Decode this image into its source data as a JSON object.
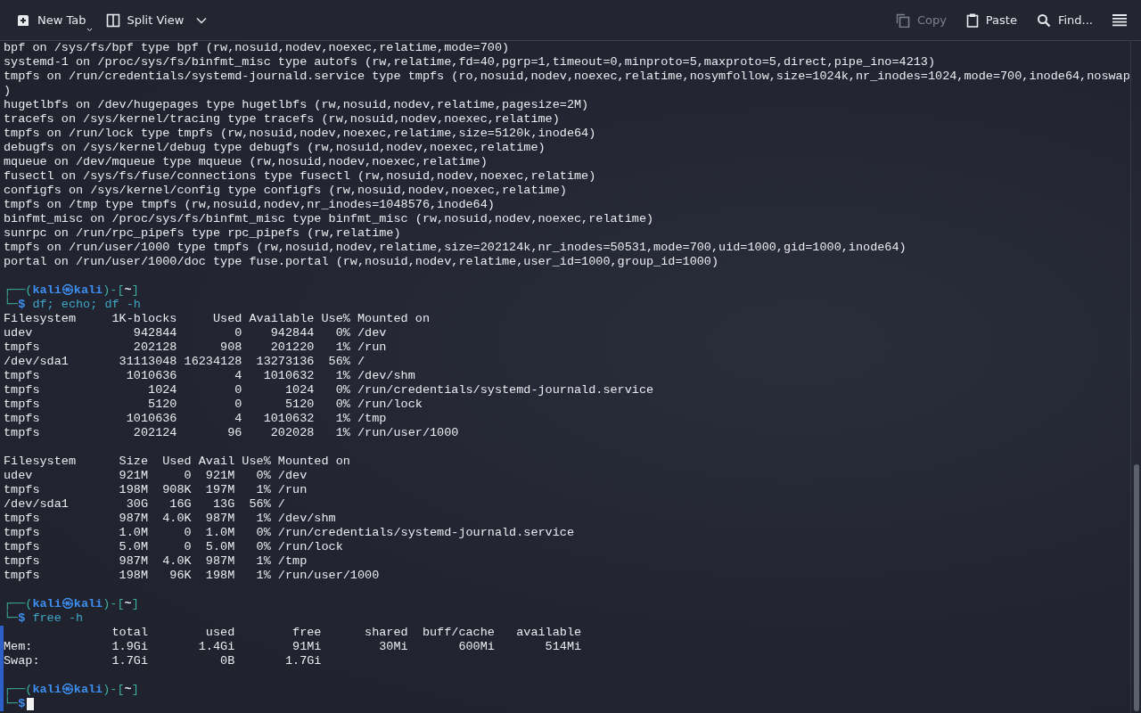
{
  "toolbar": {
    "left": [
      {
        "kind": "new-tab",
        "label": "New Tab",
        "disabled": false
      },
      {
        "kind": "split-view",
        "label": "Split View",
        "disabled": false
      }
    ],
    "right": [
      {
        "kind": "copy",
        "label": "Copy",
        "disabled": true
      },
      {
        "kind": "paste",
        "label": "Paste",
        "disabled": false
      },
      {
        "kind": "find",
        "label": "Find...",
        "disabled": false
      }
    ]
  },
  "terminal": {
    "lines": [
      {
        "kind": "output",
        "text": "bpf on /sys/fs/bpf type bpf (rw,nosuid,nodev,noexec,relatime,mode=700)",
        "marked": false
      },
      {
        "kind": "output",
        "text": "systemd-1 on /proc/sys/fs/binfmt_misc type autofs (rw,relatime,fd=40,pgrp=1,timeout=0,minproto=5,maxproto=5,direct,pipe_ino=4213)",
        "marked": false
      },
      {
        "kind": "output",
        "text": "tmpfs on /run/credentials/systemd-journald.service type tmpfs (ro,nosuid,nodev,noexec,relatime,nosymfollow,size=1024k,nr_inodes=1024,mode=700,inode64,noswap",
        "marked": false
      },
      {
        "kind": "output",
        "text": ")",
        "marked": false
      },
      {
        "kind": "output",
        "text": "hugetlbfs on /dev/hugepages type hugetlbfs (rw,nosuid,nodev,relatime,pagesize=2M)",
        "marked": false
      },
      {
        "kind": "output",
        "text": "tracefs on /sys/kernel/tracing type tracefs (rw,nosuid,nodev,noexec,relatime)",
        "marked": false
      },
      {
        "kind": "output",
        "text": "tmpfs on /run/lock type tmpfs (rw,nosuid,nodev,noexec,relatime,size=5120k,inode64)",
        "marked": false
      },
      {
        "kind": "output",
        "text": "debugfs on /sys/kernel/debug type debugfs (rw,nosuid,nodev,noexec,relatime)",
        "marked": false
      },
      {
        "kind": "output",
        "text": "mqueue on /dev/mqueue type mqueue (rw,nosuid,nodev,noexec,relatime)",
        "marked": false
      },
      {
        "kind": "output",
        "text": "fusectl on /sys/fs/fuse/connections type fusectl (rw,nosuid,nodev,noexec,relatime)",
        "marked": false
      },
      {
        "kind": "output",
        "text": "configfs on /sys/kernel/config type configfs (rw,nosuid,nodev,noexec,relatime)",
        "marked": false
      },
      {
        "kind": "output",
        "text": "tmpfs on /tmp type tmpfs (rw,nosuid,nodev,nr_inodes=1048576,inode64)",
        "marked": false
      },
      {
        "kind": "output",
        "text": "binfmt_misc on /proc/sys/fs/binfmt_misc type binfmt_misc (rw,nosuid,nodev,noexec,relatime)",
        "marked": false
      },
      {
        "kind": "output",
        "text": "sunrpc on /run/rpc_pipefs type rpc_pipefs (rw,relatime)",
        "marked": false
      },
      {
        "kind": "output",
        "text": "tmpfs on /run/user/1000 type tmpfs (rw,nosuid,nodev,relatime,size=202124k,nr_inodes=50531,mode=700,uid=1000,gid=1000,inode64)",
        "marked": false
      },
      {
        "kind": "output",
        "text": "portal on /run/user/1000/doc type fuse.portal (rw,nosuid,nodev,relatime,user_id=1000,group_id=1000)",
        "marked": false
      },
      {
        "kind": "blank",
        "marked": false
      },
      {
        "kind": "prompt",
        "open": "┌──(",
        "user": "kali",
        "at": "㉿",
        "host": "kali",
        "mid": ")-[",
        "dir": "~",
        "close": "]",
        "marked": false
      },
      {
        "kind": "command",
        "corner": "└─",
        "sign": "$",
        "command": "df; echo; df -h",
        "cursor": false,
        "marked": false
      },
      {
        "kind": "output",
        "text": "Filesystem     1K-blocks     Used Available Use% Mounted on",
        "marked": false
      },
      {
        "kind": "output",
        "text": "udev              942844        0    942844   0% /dev",
        "marked": false
      },
      {
        "kind": "output",
        "text": "tmpfs             202128      908    201220   1% /run",
        "marked": false
      },
      {
        "kind": "output",
        "text": "/dev/sda1       31113048 16234128  13273136  56% /",
        "marked": false
      },
      {
        "kind": "output",
        "text": "tmpfs            1010636        4   1010632   1% /dev/shm",
        "marked": false
      },
      {
        "kind": "output",
        "text": "tmpfs               1024        0      1024   0% /run/credentials/systemd-journald.service",
        "marked": false
      },
      {
        "kind": "output",
        "text": "tmpfs               5120        0      5120   0% /run/lock",
        "marked": false
      },
      {
        "kind": "output",
        "text": "tmpfs            1010636        4   1010632   1% /tmp",
        "marked": false
      },
      {
        "kind": "output",
        "text": "tmpfs             202124       96    202028   1% /run/user/1000",
        "marked": false
      },
      {
        "kind": "blank",
        "marked": false
      },
      {
        "kind": "output",
        "text": "Filesystem      Size  Used Avail Use% Mounted on",
        "marked": false
      },
      {
        "kind": "output",
        "text": "udev            921M     0  921M   0% /dev",
        "marked": false
      },
      {
        "kind": "output",
        "text": "tmpfs           198M  908K  197M   1% /run",
        "marked": false
      },
      {
        "kind": "output",
        "text": "/dev/sda1        30G   16G   13G  56% /",
        "marked": false
      },
      {
        "kind": "output",
        "text": "tmpfs           987M  4.0K  987M   1% /dev/shm",
        "marked": false
      },
      {
        "kind": "output",
        "text": "tmpfs           1.0M     0  1.0M   0% /run/credentials/systemd-journald.service",
        "marked": false
      },
      {
        "kind": "output",
        "text": "tmpfs           5.0M     0  5.0M   0% /run/lock",
        "marked": false
      },
      {
        "kind": "output",
        "text": "tmpfs           987M  4.0K  987M   1% /tmp",
        "marked": false
      },
      {
        "kind": "output",
        "text": "tmpfs           198M   96K  198M   1% /run/user/1000",
        "marked": false
      },
      {
        "kind": "blank",
        "marked": false
      },
      {
        "kind": "prompt",
        "open": "┌──(",
        "user": "kali",
        "at": "㉿",
        "host": "kali",
        "mid": ")-[",
        "dir": "~",
        "close": "]",
        "marked": false
      },
      {
        "kind": "command",
        "corner": "└─",
        "sign": "$",
        "command": "free -h",
        "cursor": false,
        "marked": false
      },
      {
        "kind": "output",
        "text": "               total        used        free      shared  buff/cache   available",
        "marked": true
      },
      {
        "kind": "output",
        "text": "Mem:           1.9Gi       1.4Gi        91Mi        30Mi       600Mi       514Mi",
        "marked": true
      },
      {
        "kind": "output",
        "text": "Swap:          1.7Gi          0B       1.7Gi",
        "marked": true
      },
      {
        "kind": "blank",
        "marked": true
      },
      {
        "kind": "prompt",
        "open": "┌──(",
        "user": "kali",
        "at": "㉿",
        "host": "kali",
        "mid": ")-[",
        "dir": "~",
        "close": "]",
        "marked": true
      },
      {
        "kind": "command",
        "corner": "└─",
        "sign": "$",
        "cursor": true,
        "marked": true
      }
    ]
  }
}
